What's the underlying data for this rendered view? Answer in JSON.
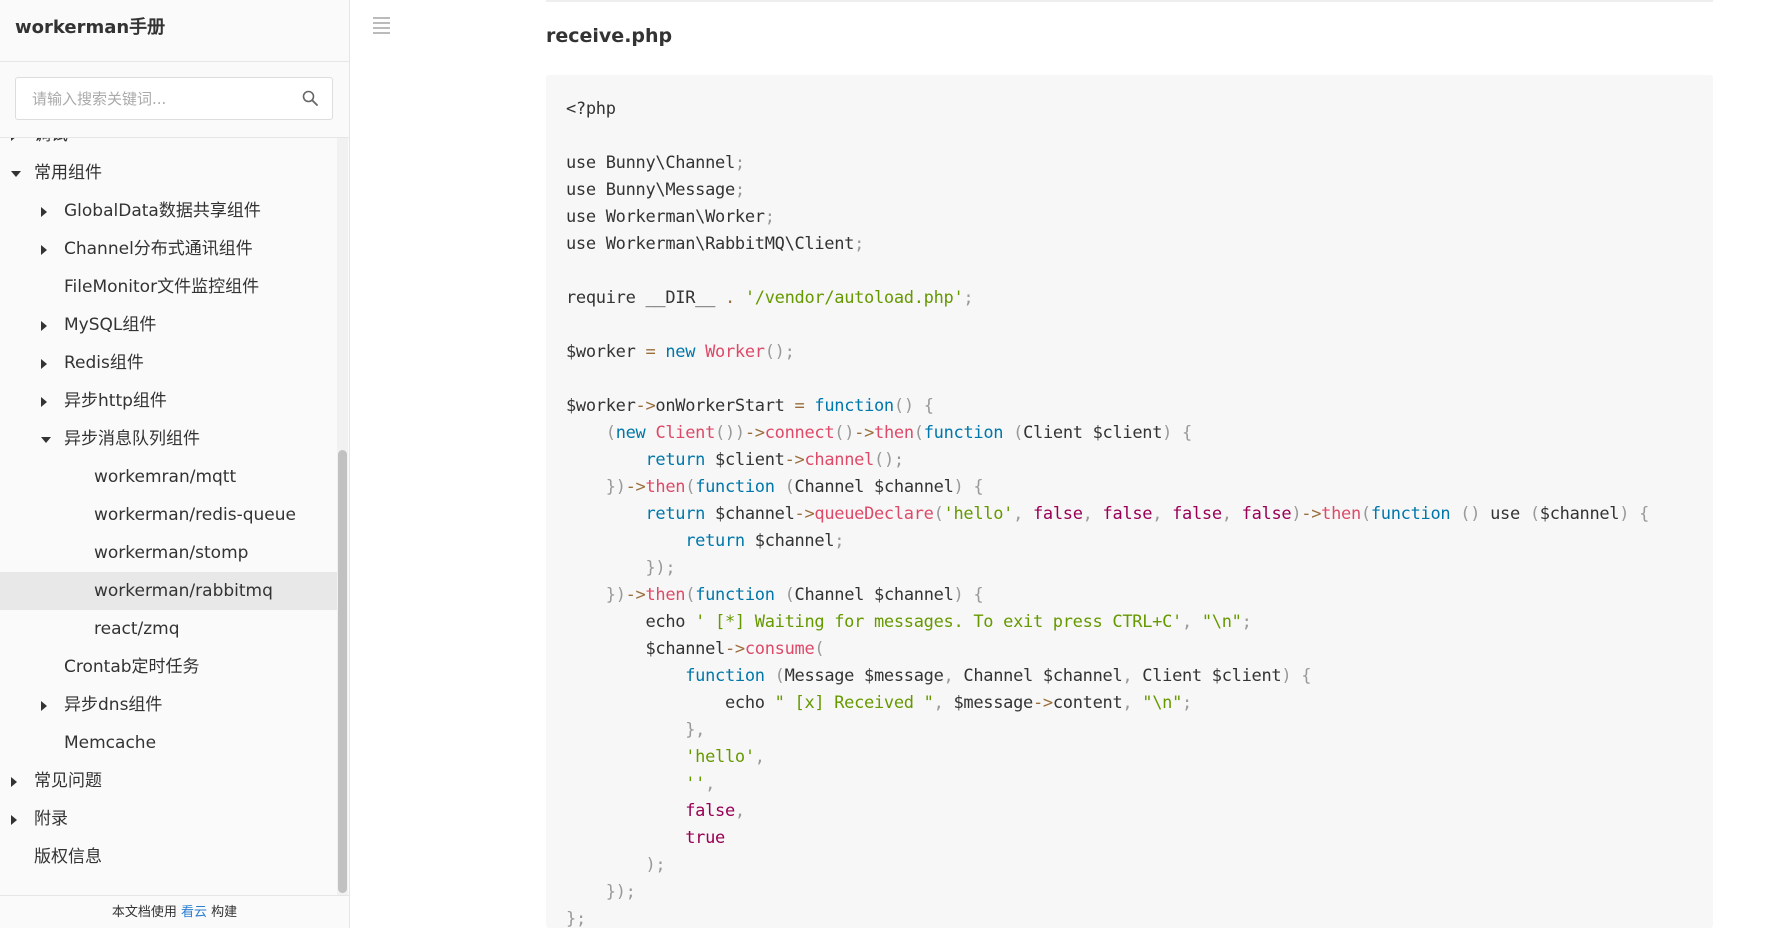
{
  "sidebar": {
    "brand": "workerman手册",
    "search_placeholder": "请输入搜索关键词...",
    "toc": [
      {
        "label": "调试",
        "level": 1,
        "arrow": "right"
      },
      {
        "label": "常用组件",
        "level": 1,
        "arrow": "down"
      },
      {
        "label": "GlobalData数据共享组件",
        "level": 2,
        "arrow": "right"
      },
      {
        "label": "Channel分布式通讯组件",
        "level": 2,
        "arrow": "right"
      },
      {
        "label": "FileMonitor文件监控组件",
        "level": 2,
        "arrow": "none"
      },
      {
        "label": "MySQL组件",
        "level": 2,
        "arrow": "right"
      },
      {
        "label": "Redis组件",
        "level": 2,
        "arrow": "right"
      },
      {
        "label": "异步http组件",
        "level": 2,
        "arrow": "right"
      },
      {
        "label": "异步消息队列组件",
        "level": 2,
        "arrow": "down"
      },
      {
        "label": "workemran/mqtt",
        "level": 3,
        "arrow": "none"
      },
      {
        "label": "workerman/redis-queue",
        "level": 3,
        "arrow": "none"
      },
      {
        "label": "workerman/stomp",
        "level": 3,
        "arrow": "none"
      },
      {
        "label": "workerman/rabbitmq",
        "level": 3,
        "arrow": "none",
        "active": true
      },
      {
        "label": "react/zmq",
        "level": 3,
        "arrow": "none"
      },
      {
        "label": "Crontab定时任务",
        "level": 2,
        "arrow": "none"
      },
      {
        "label": "异步dns组件",
        "level": 2,
        "arrow": "right"
      },
      {
        "label": "Memcache",
        "level": 2,
        "arrow": "none"
      },
      {
        "label": "常见问题",
        "level": 1,
        "arrow": "right"
      },
      {
        "label": "附录",
        "level": 1,
        "arrow": "right"
      },
      {
        "label": "版权信息",
        "level": 1,
        "arrow": "none"
      }
    ],
    "footer": {
      "prefix": "本文档使用 ",
      "link": "看云",
      "suffix": " 构建"
    }
  },
  "main": {
    "file_title": "receive.php",
    "code": "<?php\n\nuse Bunny\\Channel;\nuse Bunny\\Message;\nuse Workerman\\Worker;\nuse Workerman\\RabbitMQ\\Client;\n\nrequire __DIR__ . '/vendor/autoload.php';\n\n$worker = new Worker();\n\n$worker->onWorkerStart = function() {\n    (new Client())->connect()->then(function (Client $client) {\n        return $client->channel();\n    })->then(function (Channel $channel) {\n        return $channel->queueDeclare('hello', false, false, false, false)->then(function () use ($channel) {\n            return $channel;\n        });\n    })->then(function (Channel $channel) {\n        echo ' [*] Waiting for messages. To exit press CTRL+C', \"\\n\";\n        $channel->consume(\n            function (Message $message, Channel $channel, Client $client) {\n                echo \" [x] Received \", $message->content, \"\\n\";\n            },\n            'hello',\n            '',\n            false,\n            true\n        );\n    });\n};"
  },
  "colors": {
    "keyword": "#0077aa",
    "string": "#669900",
    "operator": "#9a6e3a",
    "function": "#dd4a68",
    "constant": "#990055",
    "punctuation": "#999999",
    "link": "#2b7fd2"
  }
}
